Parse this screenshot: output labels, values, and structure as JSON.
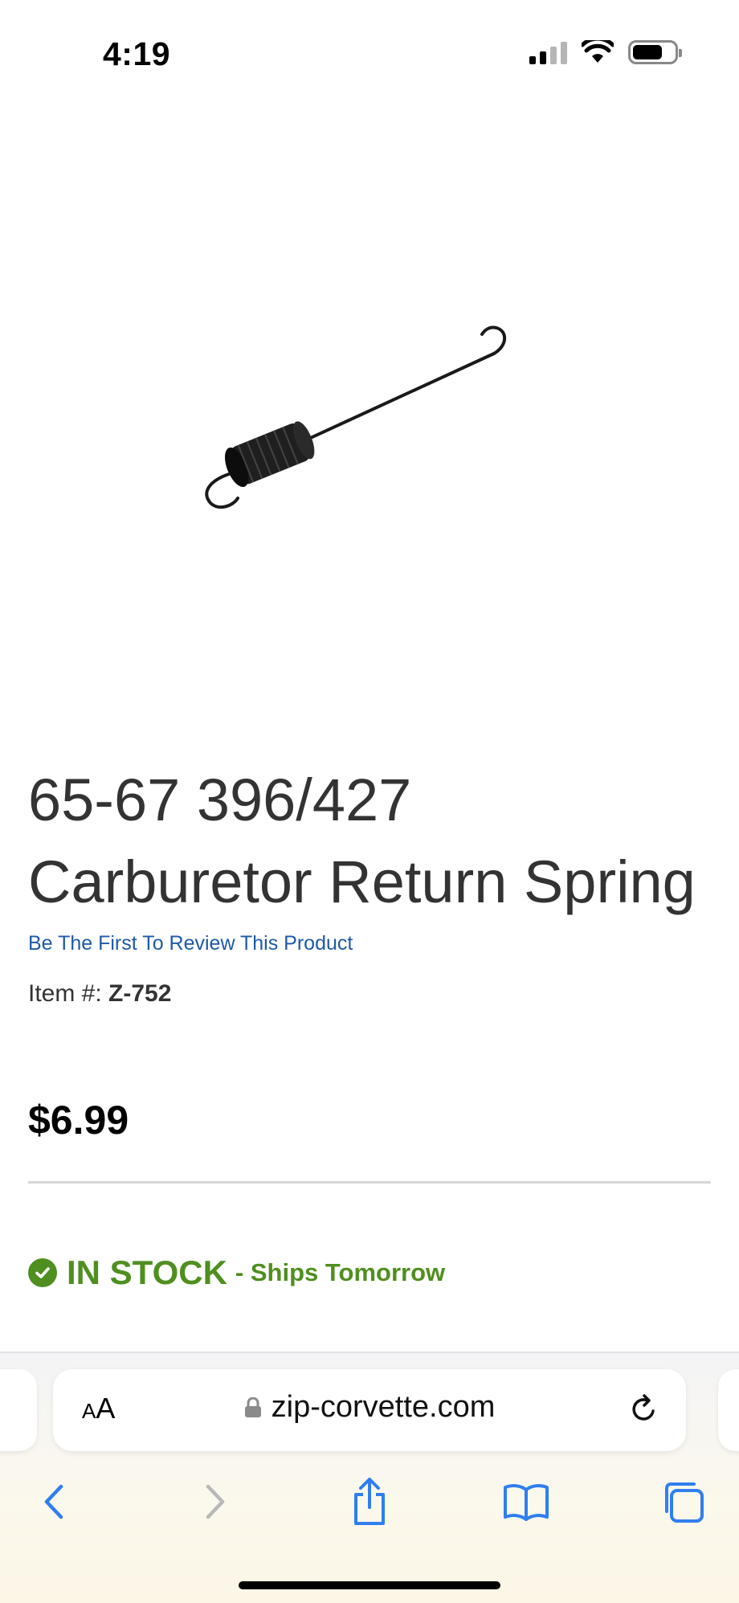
{
  "status_bar": {
    "time": "4:19",
    "icons": [
      "cellular-signal-icon",
      "wifi-icon",
      "battery-icon"
    ]
  },
  "product": {
    "image_icon": "spring-icon",
    "title_line1": "65-67 396/427",
    "title_line2": "Carburetor Return Spring",
    "review_link": "Be The First To Review This Product",
    "item_label": "Item #: ",
    "item_number": "Z-752",
    "price": "$6.99",
    "stock_status": "IN STOCK",
    "shipping": "- Ships Tomorrow"
  },
  "browser": {
    "aa_label_small": "A",
    "aa_label_large": "A",
    "url": "zip-corvette.com",
    "toolbar": [
      "back-icon",
      "forward-icon",
      "share-icon",
      "bookmarks-icon",
      "tabs-icon"
    ]
  },
  "colors": {
    "link": "#1f5aa6",
    "stock_green": "#4f8f1f",
    "title_text": "#333333",
    "accent_blue": "#2f7ff0"
  }
}
